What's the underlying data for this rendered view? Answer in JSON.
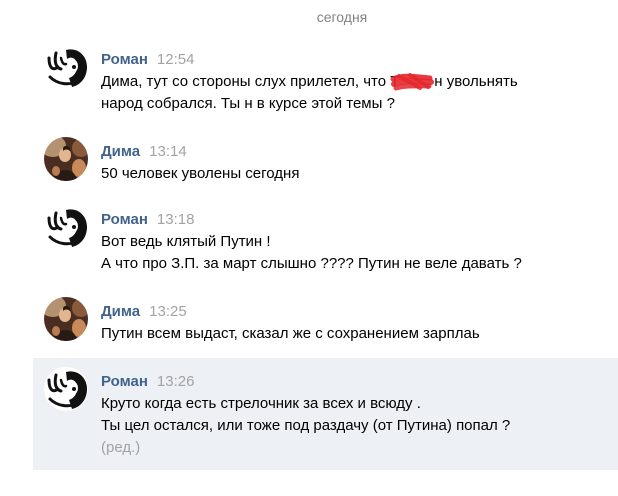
{
  "date_divider": "сегодня",
  "colors": {
    "author_name": "#42648b",
    "timestamp": "#a3a3a3",
    "message_text": "#000000",
    "date_divider": "#828282",
    "highlight_background": "#edf0f5",
    "redaction_scribble": "#e3262b"
  },
  "messages": [
    {
      "author": "Роман",
      "time": "12:54",
      "avatar_icon": "roman-avatar-icon",
      "lines": [
        {
          "before": "Дима, тут со стороны слух прилетел, что ",
          "redacted_fragment": "Т",
          "after": "н увольнять"
        },
        "народ собрался. Ты н в курсе этой темы ?"
      ]
    },
    {
      "author": "Дима",
      "time": "13:14",
      "avatar_icon": "dima-avatar-icon",
      "lines": [
        "50 человек уволены сегодня"
      ]
    },
    {
      "author": "Роман",
      "time": "13:18",
      "avatar_icon": "roman-avatar-icon",
      "lines": [
        "Вот ведь клятый Путин !",
        "А что про З.П. за март слышно ???? Путин не веле давать ?"
      ]
    },
    {
      "author": "Дима",
      "time": "13:25",
      "avatar_icon": "dima-avatar-icon",
      "lines": [
        "Путин всем выдаст, сказал же с сохранением зарплаь"
      ]
    },
    {
      "author": "Роман",
      "time": "13:26",
      "avatar_icon": "roman-avatar-icon",
      "highlighted": true,
      "lines": [
        "Круто когда есть стрелочник за всех и всюду .",
        "Ты цел остался, или тоже под раздачу (от Путина) попал ?"
      ],
      "edited_label": "(ред.)"
    }
  ]
}
